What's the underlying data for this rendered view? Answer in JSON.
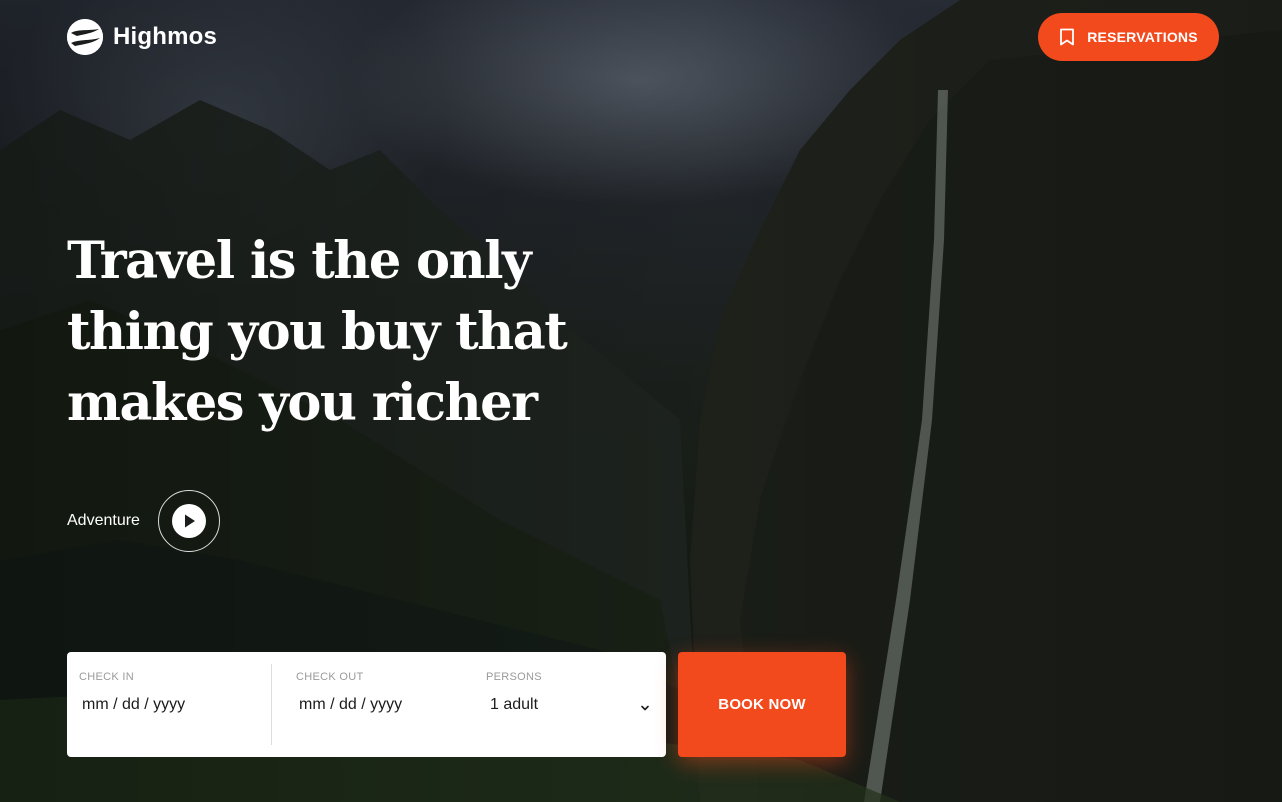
{
  "brand": {
    "name": "Highmos"
  },
  "header": {
    "reservations_label": "RESERVATIONS"
  },
  "hero": {
    "headline": "Travel is the only thing you buy that makes you richer",
    "adventure_label": "Adventure"
  },
  "booking": {
    "check_in": {
      "label": "CHECK IN",
      "value": "mm / dd / yyyy"
    },
    "check_out": {
      "label": "CHECK OUT",
      "value": "mm / dd / yyyy"
    },
    "persons": {
      "label": "PERSONS",
      "value": "1 adult"
    },
    "book_label": "BOOK NOW"
  },
  "colors": {
    "accent": "#f24a1d",
    "text_light": "#ffffff",
    "label_gray": "#9a9a9a"
  },
  "icons": {
    "logo": "plane-globe-icon",
    "reservations": "bookmark-icon",
    "play": "play-icon",
    "persons_dropdown": "chevron-down-icon"
  }
}
